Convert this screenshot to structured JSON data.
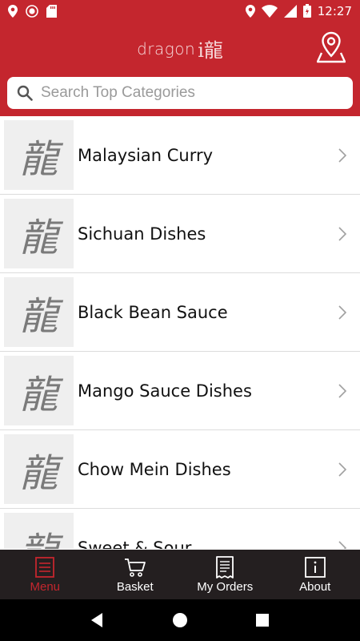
{
  "status_bar": {
    "time": "12:27"
  },
  "header": {
    "logo_text": "dragon",
    "logo_mark": "i龍"
  },
  "search": {
    "placeholder": "Search Top Categories",
    "value": ""
  },
  "categories": [
    {
      "label": "Malaysian Curry"
    },
    {
      "label": "Sichuan Dishes"
    },
    {
      "label": "Black Bean Sauce"
    },
    {
      "label": "Mango Sauce Dishes"
    },
    {
      "label": "Chow Mein Dishes"
    },
    {
      "label": "Sweet & Sour"
    }
  ],
  "thumb_glyph": "龍",
  "bottom_nav": [
    {
      "label": "Menu",
      "icon": "menu-icon",
      "active": true
    },
    {
      "label": "Basket",
      "icon": "basket-icon",
      "active": false
    },
    {
      "label": "My Orders",
      "icon": "receipt-icon",
      "active": false
    },
    {
      "label": "About",
      "icon": "info-icon",
      "active": false
    }
  ],
  "colors": {
    "brand": "#c4262e",
    "nav_bg": "#241f20",
    "active": "#c4262e"
  }
}
